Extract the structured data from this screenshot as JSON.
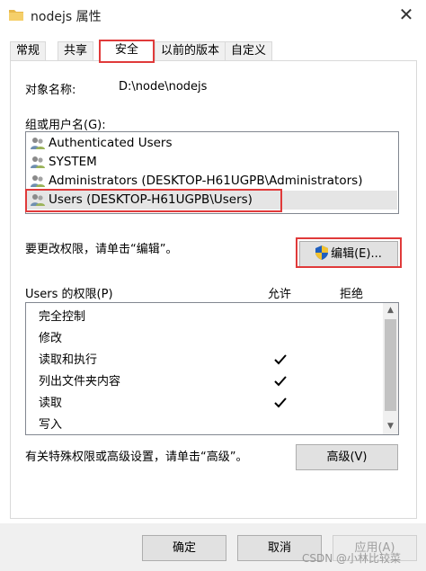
{
  "window": {
    "title": "nodejs 属性"
  },
  "tabs": [
    "常规",
    "共享",
    "安全",
    "以前的版本",
    "自定义"
  ],
  "object": {
    "label": "对象名称:",
    "value": "D:\\node\\nodejs"
  },
  "groups": {
    "label": "组或用户名(G):",
    "items": [
      "Authenticated Users",
      "SYSTEM",
      "Administrators (DESKTOP-H61UGPB\\Administrators)",
      "Users (DESKTOP-H61UGPB\\Users)"
    ]
  },
  "edit": {
    "hint": "要更改权限，请单击“编辑”。",
    "button": "编辑(E)..."
  },
  "permissions": {
    "label": "Users 的权限(P)",
    "allow": "允许",
    "deny": "拒绝",
    "items": [
      "完全控制",
      "修改",
      "读取和执行",
      "列出文件夹内容",
      "读取",
      "写入"
    ],
    "allowed": [
      false,
      false,
      true,
      true,
      true,
      false
    ]
  },
  "advanced": {
    "hint": "有关特殊权限或高级设置，请单击“高级”。",
    "button": "高级(V)"
  },
  "footer": {
    "ok": "确定",
    "cancel": "取消",
    "apply": "应用(A)"
  },
  "watermark": "CSDN @小林比较菜",
  "colors": {
    "highlight": "#e03a3a",
    "selection": "#e5e5e5",
    "shield_blue": "#1f5fbf",
    "shield_yellow": "#f2c230"
  }
}
